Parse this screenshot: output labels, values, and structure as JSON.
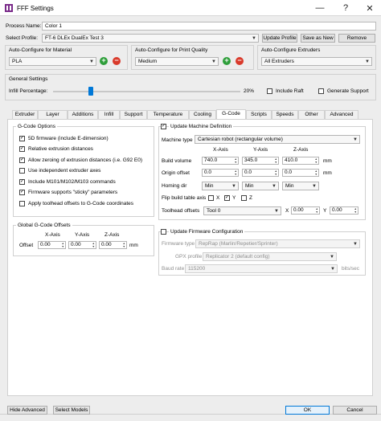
{
  "window": {
    "title": "FFF Settings",
    "minimize": "—",
    "help": "?",
    "close": "✕"
  },
  "process": {
    "label": "Process Name:",
    "value": "Color 1"
  },
  "profile": {
    "label": "Select Profile:",
    "value": "FT-6 DLEx DualEx Test 3",
    "update": "Update Profile",
    "save_as_new": "Save as New",
    "remove": "Remove"
  },
  "auto_material": {
    "label": "Auto-Configure for Material",
    "value": "PLA"
  },
  "auto_quality": {
    "label": "Auto-Configure for Print Quality",
    "value": "Medium"
  },
  "auto_extruders": {
    "label": "Auto-Configure Extruders",
    "value": "All Extruders"
  },
  "general": {
    "label": "General Settings",
    "infill_label": "Infill Percentage:",
    "infill_value": "20%",
    "infill_fraction": 0.2,
    "include_raft": "Include Raft",
    "generate_support": "Generate Support"
  },
  "tabs": [
    "Extruder",
    "Layer",
    "Additions",
    "Infill",
    "Support",
    "Temperature",
    "Cooling",
    "G-Code",
    "Scripts",
    "Speeds",
    "Other",
    "Advanced"
  ],
  "active_tab": "G-Code",
  "gcode_options": {
    "title": "G-Code Options",
    "items": [
      {
        "label": "5D firmware (include E-dimension)",
        "checked": true
      },
      {
        "label": "Relative extrusion distances",
        "checked": true
      },
      {
        "label": "Allow zeroing of extrusion distances (i.e. G92 E0)",
        "checked": true
      },
      {
        "label": "Use independent extruder axes",
        "checked": false
      },
      {
        "label": "Include M101/M102/M103 commands",
        "checked": true
      },
      {
        "label": "Firmware supports \"sticky\" parameters",
        "checked": true
      },
      {
        "label": "Apply toolhead offsets to G-Code coordinates",
        "checked": false
      }
    ]
  },
  "offsets": {
    "title": "Global G-Code Offsets",
    "x_axis": "X-Axis",
    "y_axis": "Y-Axis",
    "z_axis": "Z-Axis",
    "row_label": "Offset",
    "x": "0.00",
    "y": "0.00",
    "z": "0.00",
    "unit": "mm"
  },
  "machine": {
    "title": "Update Machine Definition",
    "checked": true,
    "type_label": "Machine type",
    "type_value": "Cartesian robot (rectangular volume)",
    "x_axis": "X-Axis",
    "y_axis": "Y-Axis",
    "z_axis": "Z-Axis",
    "build_label": "Build volume",
    "build_x": "740.0",
    "build_y": "345.0",
    "build_z": "410.0",
    "origin_label": "Origin offset",
    "origin_x": "0.0",
    "origin_y": "0.0",
    "origin_z": "0.0",
    "unit": "mm",
    "homing_label": "Homing dir",
    "homing_x": "Min",
    "homing_y": "Min",
    "homing_z": "Min",
    "flip_label": "Flip build table axis",
    "flip_x": "X",
    "flip_y": "Y",
    "flip_z": "Z",
    "toolhead_label": "Toolhead offsets",
    "toolhead_value": "Tool 0",
    "tool_x_label": "X",
    "tool_x": "0.00",
    "tool_y_label": "Y",
    "tool_y": "0.00"
  },
  "firmware": {
    "title": "Update Firmware Configuration",
    "checked": false,
    "type_label": "Firmware type",
    "type_value": "RepRap (Marlin/Repetier/Sprinter)",
    "gpx_label": "GPX profile",
    "gpx_value": "Replicator 2 (default config)",
    "baud_label": "Baud rate",
    "baud_value": "115200",
    "baud_unit": "bits/sec"
  },
  "footer": {
    "hide_advanced": "Hide Advanced",
    "select_models": "Select Models",
    "ok": "OK",
    "cancel": "Cancel"
  }
}
